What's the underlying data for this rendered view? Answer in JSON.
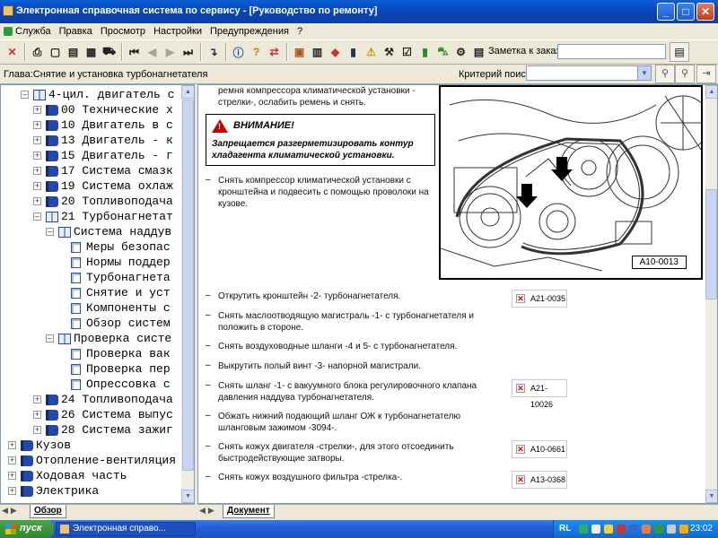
{
  "window": {
    "title": "Электронная справочная система по сервису - [Руководство по ремонту]"
  },
  "menu": [
    "Служба",
    "Правка",
    "Просмотр",
    "Настройки",
    "Предупреждения",
    "?"
  ],
  "toolbar": {
    "note_label": "Заметка к заказу:",
    "note_value": ""
  },
  "chapter": "Глава:Снятие и установка турбонагнетателя",
  "search": {
    "label": "Критерий поиска:",
    "value": ""
  },
  "tree": [
    {
      "label": "4-цил. двигатель с",
      "depth": 0,
      "icon": "book-open",
      "pm": "-"
    },
    {
      "label": "00 Технические х",
      "depth": 1,
      "icon": "book",
      "pm": "+"
    },
    {
      "label": "10 Двигатель в с",
      "depth": 1,
      "icon": "book",
      "pm": "+"
    },
    {
      "label": "13 Двигатель - к",
      "depth": 1,
      "icon": "book",
      "pm": "+"
    },
    {
      "label": "15 Двигатель - г",
      "depth": 1,
      "icon": "book",
      "pm": "+"
    },
    {
      "label": "17 Система смазк",
      "depth": 1,
      "icon": "book",
      "pm": "+"
    },
    {
      "label": "19 Система охлаж",
      "depth": 1,
      "icon": "book",
      "pm": "+"
    },
    {
      "label": "20 Топливоподача",
      "depth": 1,
      "icon": "book",
      "pm": "+"
    },
    {
      "label": "21 Турбонагнетат",
      "depth": 1,
      "icon": "book-open",
      "pm": "-"
    },
    {
      "label": "Система наддув",
      "depth": 2,
      "icon": "book-open",
      "pm": "-"
    },
    {
      "label": "Меры безопас",
      "depth": 3,
      "icon": "page",
      "pm": ""
    },
    {
      "label": "Нормы поддер",
      "depth": 3,
      "icon": "page",
      "pm": ""
    },
    {
      "label": "Турбонагнета",
      "depth": 3,
      "icon": "page",
      "pm": ""
    },
    {
      "label": "Снятие и уст",
      "depth": 3,
      "icon": "page",
      "pm": ""
    },
    {
      "label": "Компоненты с",
      "depth": 3,
      "icon": "page",
      "pm": ""
    },
    {
      "label": "Обзор систем",
      "depth": 3,
      "icon": "page",
      "pm": ""
    },
    {
      "label": "Проверка систе",
      "depth": 2,
      "icon": "book-open",
      "pm": "-"
    },
    {
      "label": "Проверка вак",
      "depth": 3,
      "icon": "page",
      "pm": ""
    },
    {
      "label": "Проверка пер",
      "depth": 3,
      "icon": "page",
      "pm": ""
    },
    {
      "label": "Опрессовка с",
      "depth": 3,
      "icon": "page",
      "pm": ""
    },
    {
      "label": "24 Топливоподача",
      "depth": 1,
      "icon": "book",
      "pm": "+"
    },
    {
      "label": "26 Система выпус",
      "depth": 1,
      "icon": "book",
      "pm": "+"
    },
    {
      "label": "28 Система зажиг",
      "depth": 1,
      "icon": "book",
      "pm": "+"
    },
    {
      "label": "Кузов",
      "depth": -1,
      "icon": "book",
      "pm": "+"
    },
    {
      "label": "Отопление-вентиляция",
      "depth": -1,
      "icon": "book",
      "pm": "+"
    },
    {
      "label": "Ходовая часть",
      "depth": -1,
      "icon": "book",
      "pm": "+"
    },
    {
      "label": "Электрика",
      "depth": -1,
      "icon": "book",
      "pm": "+"
    }
  ],
  "tabs": {
    "left": "Обзор",
    "right": "Документ"
  },
  "document": {
    "intro": [
      "ремня компрессора климатической установки -",
      "стрелки-, ослабить ремень и снять."
    ],
    "warning_title": "ВНИМАНИЕ!",
    "warning_text": "Запрещается разгерметизировать контур хладагента климатической установки.",
    "figure_label": "A10-0013",
    "steps": [
      {
        "text": "Снять компрессор климатической установки с кронштейна и подвесить с помощью проволоки на кузове.",
        "ref": ""
      },
      {
        "text": "Открутить кронштейн -2- турбонагнетателя.",
        "ref": "A21-0035"
      },
      {
        "text": "Снять маслоотводящую магистраль -1- с турбонагнетателя и положить в стороне.",
        "ref": ""
      },
      {
        "text": "Снять воздуховодные шланги -4 и 5- с турбонагнетателя.",
        "ref": ""
      },
      {
        "text": "Выкрутить полый винт -3- напорной магистрали.",
        "ref": ""
      },
      {
        "text": "Снять шланг -1- с вакуумного блока регулировочного клапана давления наддува турбонагнетателя.",
        "ref": "A21-10026"
      },
      {
        "text": "Обжать нижний подающий шланг ОЖ к турбонагнетателю шланговым зажимом -3094-.",
        "ref": ""
      },
      {
        "text": "Снять кожух двигателя -стрелки-, для этого отсоединить быстродействующие затворы.",
        "ref": "A10-0661"
      },
      {
        "text": "Снять кожух воздушного фильтра -стрелка-.",
        "ref": "A13-0368"
      }
    ]
  },
  "taskbar": {
    "start": "пуск",
    "item": "Электронная справо...",
    "lang": "RL",
    "clock": "23:02"
  }
}
